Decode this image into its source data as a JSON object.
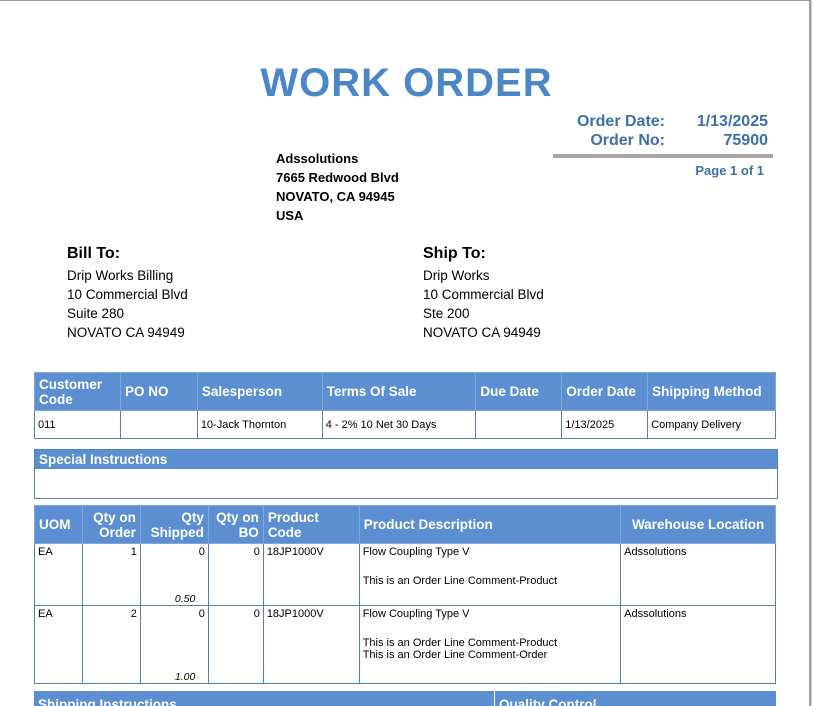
{
  "document": {
    "title": "WORK ORDER",
    "order_date_label": "Order Date:",
    "order_date": "1/13/2025",
    "order_no_label": "Order No:",
    "order_no": "75900",
    "page": "Page 1 of 1"
  },
  "company": {
    "name": "Adssolutions",
    "line1": "7665 Redwood Blvd",
    "line2": "NOVATO, CA 94945",
    "line3": "USA"
  },
  "bill_to": {
    "heading": "Bill To:",
    "lines": [
      "Drip Works Billing",
      "10 Commercial Blvd",
      "Suite 280",
      "NOVATO CA 94949"
    ]
  },
  "ship_to": {
    "heading": "Ship To:",
    "lines": [
      "Drip Works",
      "10 Commercial Blvd",
      "Ste 200",
      "NOVATO CA 94949"
    ]
  },
  "order_info": {
    "headers": [
      "Customer Code",
      "PO NO",
      "Salesperson",
      "Terms Of Sale",
      "Due Date",
      "Order Date",
      "Shipping Method"
    ],
    "values": [
      "011",
      "",
      "10-Jack Thornton",
      "4 - 2% 10 Net 30 Days",
      "",
      "1/13/2025",
      "Company Delivery"
    ]
  },
  "special_instructions": {
    "heading": "Special Instructions",
    "text": ""
  },
  "lines_table": {
    "headers": [
      "UOM",
      "Qty on Order",
      "Qty Shipped",
      "Qty on BO",
      "Product Code",
      "Product Description",
      "Warehouse Location"
    ],
    "rows": [
      {
        "uom": "EA",
        "qty_order": "1",
        "qty_shipped": "0",
        "qty_shipped_sub": "0.50",
        "qty_bo": "0",
        "product_code": "18JP1000V",
        "description": "Flow Coupling Type V",
        "comment1": "This is an Order Line Comment-Product",
        "comment2": "",
        "warehouse": "Adssolutions"
      },
      {
        "uom": "EA",
        "qty_order": "2",
        "qty_shipped": "0",
        "qty_shipped_sub": "1.00",
        "qty_bo": "0",
        "product_code": "18JP1000V",
        "description": "Flow Coupling Type V",
        "comment1": "This is an Order Line Comment-Product",
        "comment2": "This is an Order Line Comment-Order",
        "warehouse": "Adssolutions"
      }
    ]
  },
  "footer": {
    "shipping_instructions": "Shipping Instructions",
    "quality_control": "Quality Control"
  },
  "colors": {
    "accent": "#4a86c8",
    "header_fill": "#5b8fd2",
    "border": "#4f81bd"
  }
}
